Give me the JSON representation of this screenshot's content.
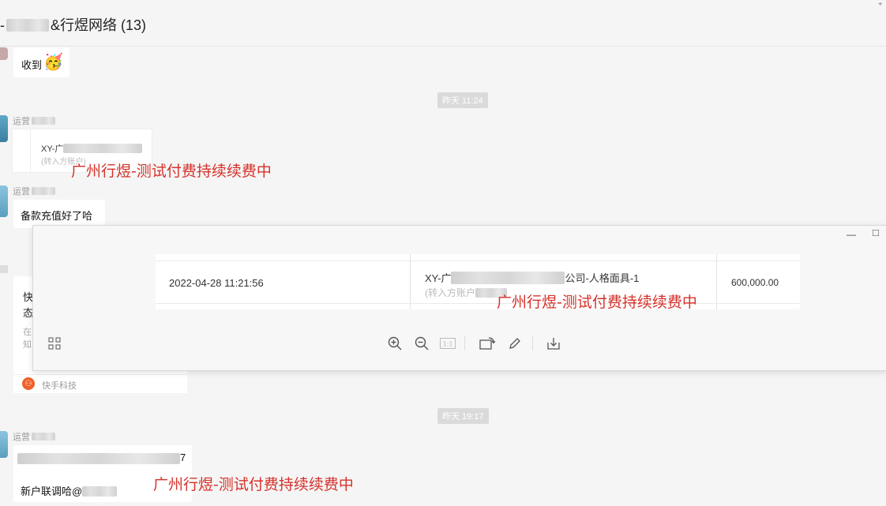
{
  "header": {
    "title_prefix": "-",
    "title_suffix": "&行煜网络 (13)",
    "corner_mark": "⁺"
  },
  "messages": {
    "received_text": "收到",
    "received_emoji": "🥳",
    "time1": "昨天 11:24",
    "sender1": "运营",
    "card1_title": "XY-广",
    "card1_sub": "(转入方账户)",
    "sender2": "运营",
    "bubble2": "备款充值好了哈",
    "left_card_line1": "快",
    "left_card_line2": "态",
    "left_card_line3": "在",
    "left_card_line4": "知",
    "left_card_footer": "快手科技",
    "time2": "昨天 19:17",
    "sender3": "运营",
    "bubble3_tail": "7",
    "bubble3_line2": "新户联调哈@"
  },
  "watermark": "广州行煜-测试付费持续续费中",
  "viewer": {
    "minimize": "—",
    "maximize": "□",
    "date": "2022-04-28 11:21:56",
    "account_prefix": "XY-广",
    "account_suffix": "公司-人格面具-1",
    "account_sub": "(转入方账户",
    "amount": "600,000.00",
    "toolbar": {
      "grid_icon": "grid-icon",
      "zoom_in_icon": "zoom-in-icon",
      "zoom_out_icon": "zoom-out-icon",
      "actual_size_icon": "actual-size-icon",
      "rotate_icon": "rotate-icon",
      "edit_icon": "edit-icon",
      "download_icon": "download-icon"
    }
  }
}
